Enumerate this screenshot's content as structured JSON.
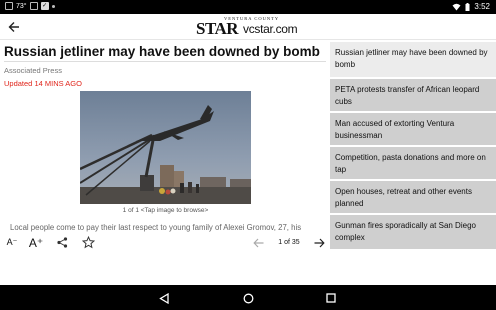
{
  "status_bar": {
    "temperature": "73°",
    "time": "3:52"
  },
  "app_bar": {
    "logo_top": "VENTURA COUNTY",
    "logo_star": "STAR",
    "logo_site": "vcstar.com"
  },
  "article": {
    "headline": "Russian jetliner may have been downed by bomb",
    "source": "Associated Press",
    "updated": "Updated 14 MINS AGO",
    "caption": "1 of 1 <Tap image to browse>",
    "body_snippet": "Local people come to pay their last respect to young family of Alexei Gromov, 27, his"
  },
  "toolbar": {
    "font_small": "A⁻",
    "font_large": "A⁺",
    "pager": "1 of 35"
  },
  "stories": [
    {
      "title": "Russian jetliner may have been downed by bomb"
    },
    {
      "title": "PETA protests transfer of African leopard cubs"
    },
    {
      "title": "Man accused of extorting Ventura businessman"
    },
    {
      "title": "Competition, pasta donations and more on tap"
    },
    {
      "title": "Open houses, retreat and other events planned"
    },
    {
      "title": "Gunman fires sporadically at San Diego complex"
    }
  ],
  "colors": {
    "updated_red": "#e0251b",
    "list_bg": "#cfcfcf",
    "list_active_bg": "#ececec"
  }
}
